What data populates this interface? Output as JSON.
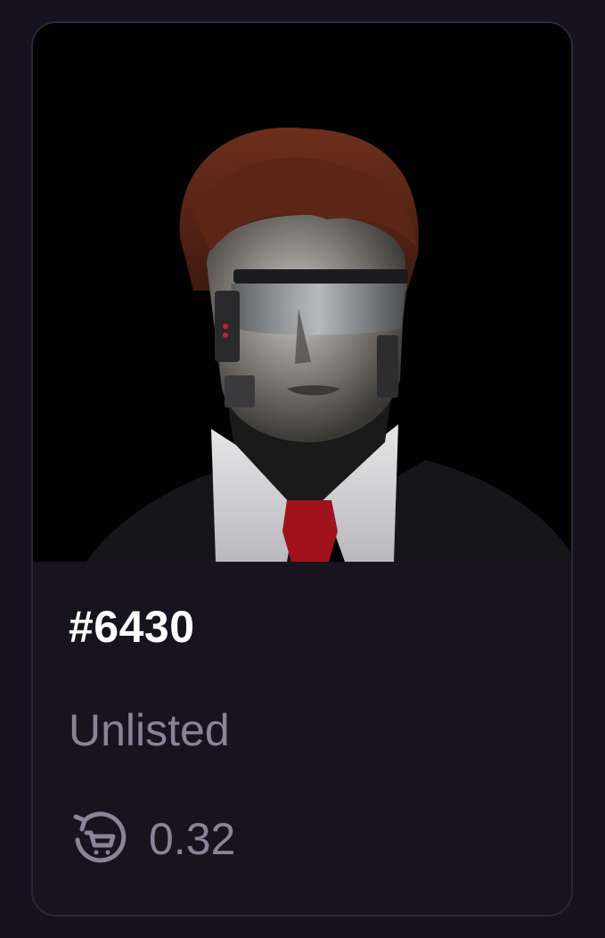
{
  "card": {
    "token_id": "#6430",
    "status": "Unlisted",
    "last_sale_icon": "cart-refresh-icon",
    "last_sale_price": "0.32"
  },
  "colors": {
    "page_background": "#16121f",
    "card_background": "#17141f",
    "card_border": "#2c2739",
    "title_text": "#ffffff",
    "muted_text": "#8a8499"
  }
}
